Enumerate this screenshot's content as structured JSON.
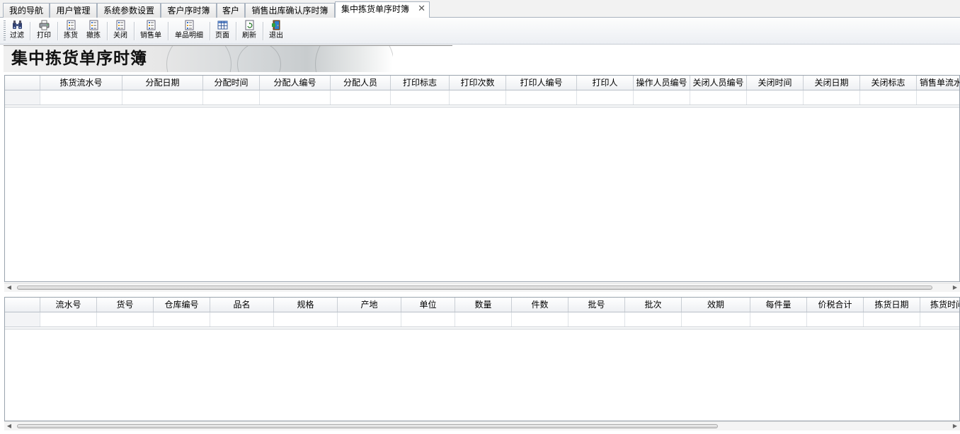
{
  "tabs": [
    {
      "label": "我的导航"
    },
    {
      "label": "用户管理"
    },
    {
      "label": "系统参数设置"
    },
    {
      "label": "客户序时簿"
    },
    {
      "label": "客户"
    },
    {
      "label": "销售出库确认序时簿"
    },
    {
      "label": "集中拣货单序时簿",
      "active": true,
      "close": "✕"
    }
  ],
  "toolbar": {
    "filter": "过滤",
    "print": "打印",
    "pick": "拣货",
    "undo_pick": "撤拣",
    "close": "关闭",
    "sales_order": "销售单",
    "item_detail": "单品明细",
    "page": "页面",
    "refresh": "刷新",
    "exit": "退出"
  },
  "banner": {
    "title": "集中拣货单序时簿"
  },
  "master_grid": {
    "columns": [
      "拣货流水号",
      "分配日期",
      "分配时间",
      "分配人编号",
      "分配人员",
      "打印标志",
      "打印次数",
      "打印人编号",
      "打印人",
      "操作人员编号",
      "关闭人员编号",
      "关闭时间",
      "关闭日期",
      "关闭标志",
      "销售单流水"
    ]
  },
  "detail_grid": {
    "columns": [
      "流水号",
      "货号",
      "仓库编号",
      "品名",
      "规格",
      "产地",
      "单位",
      "数量",
      "件数",
      "批号",
      "批次",
      "效期",
      "每件量",
      "价税合计",
      "拣货日期",
      "拣货时间"
    ]
  },
  "colors": {
    "border": "#9aa4ae",
    "header_bg": "#eef0f3",
    "tab_active": "#ffffff"
  }
}
